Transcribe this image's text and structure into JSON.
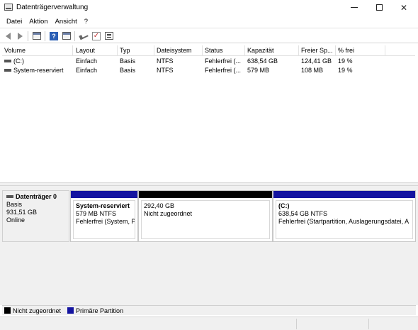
{
  "window": {
    "title": "Datenträgerverwaltung",
    "minimize_glyph": "—",
    "maximize_glyph": "☐",
    "close_glyph": "✕"
  },
  "menu": {
    "items": [
      "Datei",
      "Aktion",
      "Ansicht",
      "?"
    ]
  },
  "toolbar": {
    "icons": [
      "back-arrow-icon",
      "forward-arrow-icon",
      "console-tree-icon",
      "help-icon",
      "properties-icon",
      "key-icon",
      "check-icon",
      "list-view-icon"
    ]
  },
  "volumes": {
    "columns": [
      "Volume",
      "Layout",
      "Typ",
      "Dateisystem",
      "Status",
      "Kapazität",
      "Freier Sp...",
      "% frei"
    ],
    "rows": [
      {
        "volume": "(C:)",
        "layout": "Einfach",
        "typ": "Basis",
        "dateisystem": "NTFS",
        "status": "Fehlerfrei (...",
        "kapazitaet": "638,54 GB",
        "frei": "124,41 GB",
        "prozent": "19 %"
      },
      {
        "volume": "System-reserviert",
        "layout": "Einfach",
        "typ": "Basis",
        "dateisystem": "NTFS",
        "status": "Fehlerfrei (...",
        "kapazitaet": "579 MB",
        "frei": "108 MB",
        "prozent": "19 %"
      }
    ]
  },
  "disk": {
    "name": "Datenträger 0",
    "type": "Basis",
    "size": "931,51 GB",
    "state": "Online",
    "partitions": [
      {
        "title": "System-reserviert",
        "size": "579 MB NTFS",
        "status": "Fehlerfrei (System, P",
        "color": "#1414a0"
      },
      {
        "title": "",
        "size": "292,40 GB",
        "status": "Nicht zugeordnet",
        "color": "#000000"
      },
      {
        "title": "(C:)",
        "size": "638,54 GB NTFS",
        "status": "Fehlerfrei (Startpartition, Auslagerungsdatei, A",
        "color": "#1414a0"
      }
    ]
  },
  "legend": {
    "items": [
      {
        "label": "Nicht zugeordnet",
        "color": "#000000"
      },
      {
        "label": "Primäre Partition",
        "color": "#1414a0"
      }
    ]
  }
}
